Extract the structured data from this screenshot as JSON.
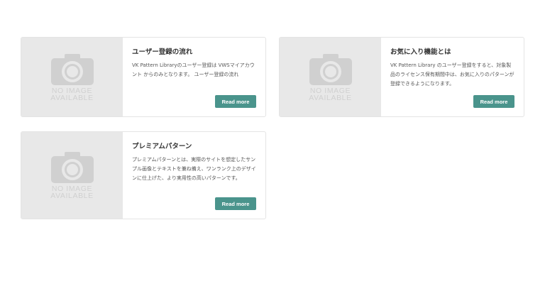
{
  "colors": {
    "button_bg": "#4a948c",
    "thumb_bg": "#e8e8e8",
    "card_border": "#e4e4e4"
  },
  "placeholder": {
    "icon": "camera-icon",
    "line1": "NO IMAGE",
    "line2": "AVAILABLE"
  },
  "cards": [
    {
      "title": "ユーザー登録の流れ",
      "description": "VK Pattern Libraryのユーザー登録は VWSマイアカウント からのみとなります。 ユーザー登録の流れ",
      "button_label": "Read more"
    },
    {
      "title": "お気に入り機能とは",
      "description": "VK Pattern Library のユーザー登録をすると、対象製品のライセンス保有期間中は、お気に入りのパターンが登録できるようになります。",
      "button_label": "Read more"
    },
    {
      "title": "プレミアムパターン",
      "description": "プレミアムパターンとは、実際のサイトを想定したサンプル画像とテキストを兼ね備え、ワンランク上のデザインに仕上げた、より実用性の高いパターンです。",
      "button_label": "Read more"
    }
  ]
}
